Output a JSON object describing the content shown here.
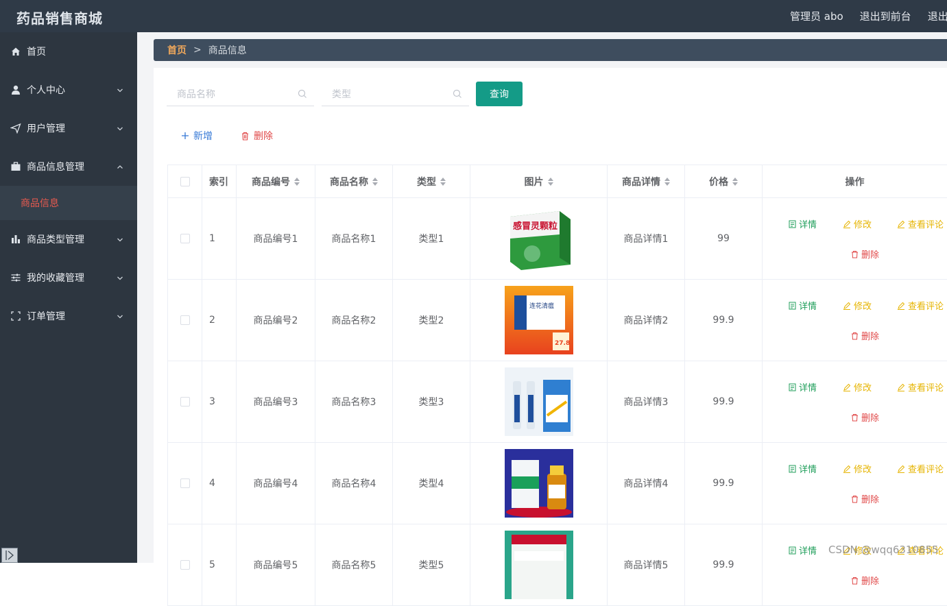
{
  "app": {
    "title": "药品销售商城"
  },
  "topbar": {
    "user": "管理员 abo",
    "to_front": "退出到前台",
    "logout": "退出登录"
  },
  "sidebar": {
    "items": [
      {
        "label": "首页",
        "icon": "home-icon",
        "chevron": false
      },
      {
        "label": "个人中心",
        "icon": "user-icon",
        "chevron": true
      },
      {
        "label": "用户管理",
        "icon": "send-icon",
        "chevron": true
      },
      {
        "label": "商品信息管理",
        "icon": "briefcase-icon",
        "chevron": true,
        "expanded": true
      },
      {
        "label": "商品类型管理",
        "icon": "bar-chart-icon",
        "chevron": true
      },
      {
        "label": "我的收藏管理",
        "icon": "sliders-icon",
        "chevron": true
      },
      {
        "label": "订单管理",
        "icon": "frame-icon",
        "chevron": true
      }
    ],
    "sub_item": "商品信息"
  },
  "breadcrumb": {
    "home": "首页",
    "sep": ">",
    "current": "商品信息"
  },
  "search": {
    "name_placeholder": "商品名称",
    "type_placeholder": "类型",
    "query": "查询"
  },
  "actions": {
    "add": "新增",
    "delete": "删除"
  },
  "table": {
    "headers": [
      "索引",
      "商品编号",
      "商品名称",
      "类型",
      "图片",
      "商品详情",
      "价格",
      "操作"
    ],
    "rows": [
      {
        "index": "1",
        "code": "商品编号1",
        "name": "商品名称1",
        "type": "类型1",
        "detail": "商品详情1",
        "price": "99"
      },
      {
        "index": "2",
        "code": "商品编号2",
        "name": "商品名称2",
        "type": "类型2",
        "detail": "商品详情2",
        "price": "99.9"
      },
      {
        "index": "3",
        "code": "商品编号3",
        "name": "商品名称3",
        "type": "类型3",
        "detail": "商品详情3",
        "price": "99.9"
      },
      {
        "index": "4",
        "code": "商品编号4",
        "name": "商品名称4",
        "type": "类型4",
        "detail": "商品详情4",
        "price": "99.9"
      },
      {
        "index": "5",
        "code": "商品编号5",
        "name": "商品名称5",
        "type": "类型5",
        "detail": "商品详情5",
        "price": "99.9"
      }
    ],
    "ops": {
      "detail": "详情",
      "edit": "修改",
      "comment": "查看评论",
      "delete": "删除"
    }
  },
  "watermark": "CSDN @wqq6310855",
  "colors": {
    "topbar": "#2f3a47",
    "sidebar": "#2d3640",
    "accent": "#149b87",
    "active": "#e85a4f"
  }
}
